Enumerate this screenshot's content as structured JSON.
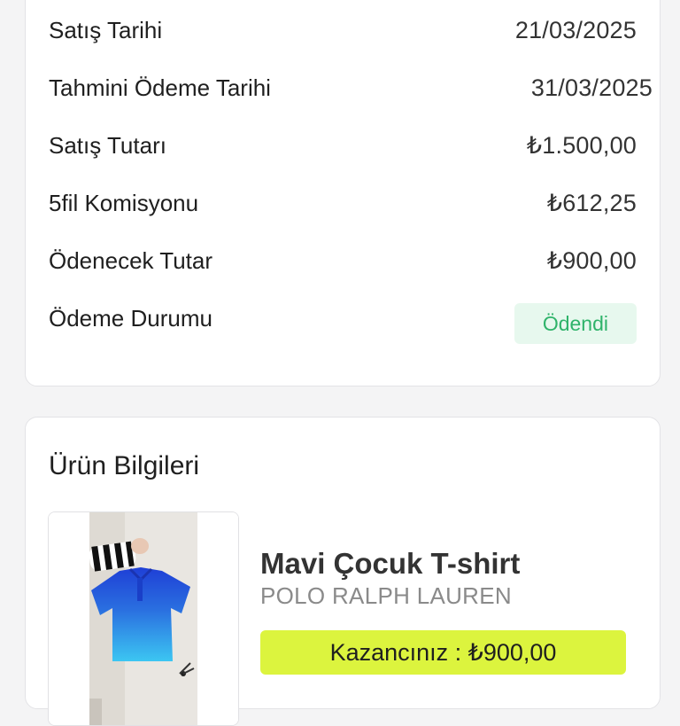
{
  "summary": {
    "rows": [
      {
        "label": "Satış Tarihi",
        "value": "21/03/2025"
      },
      {
        "label": "Tahmini Ödeme Tarihi",
        "value": "31/03/2025"
      },
      {
        "label": "Satış Tutarı",
        "value": "₺1.500,00"
      },
      {
        "label": "5fil Komisyonu",
        "value": "₺612,25"
      },
      {
        "label": "Ödenecek Tutar",
        "value": "₺900,00"
      }
    ],
    "status_label": "Ödeme Durumu",
    "status_value": "Ödendi",
    "status_color": "#2fb36a",
    "status_bg": "#e7f8ee"
  },
  "product": {
    "section_title": "Ürün Bilgileri",
    "name": "Mavi Çocuk T-shirt",
    "brand": "POLO RALPH LAUREN",
    "earnings_label": "Kazancınız : ₺900,00",
    "earnings_bg": "#dcf43e",
    "image_icon": "product-photo"
  }
}
